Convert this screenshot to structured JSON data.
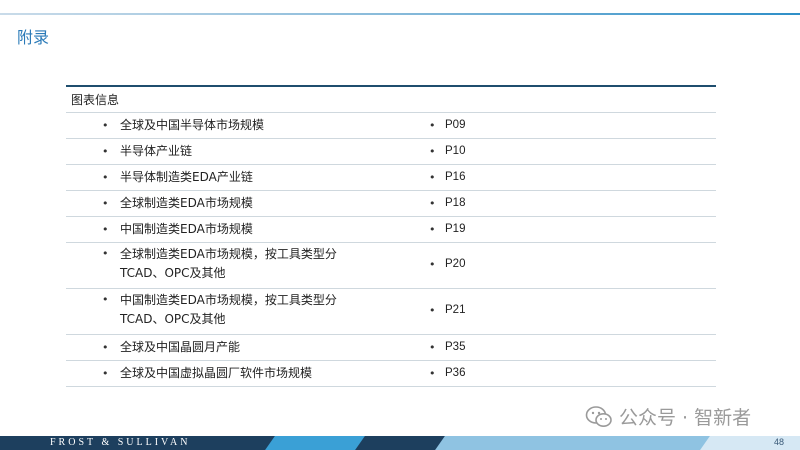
{
  "page": {
    "title": "附录",
    "page_number": "48"
  },
  "table": {
    "header": "图表信息",
    "bullet": "•",
    "rows": [
      {
        "lines": [
          "全球及中国半导体市场规模"
        ],
        "page": "P09"
      },
      {
        "lines": [
          "半导体产业链"
        ],
        "page": "P10"
      },
      {
        "lines": [
          "半导体制造类EDA产业链"
        ],
        "page": "P16"
      },
      {
        "lines": [
          "全球制造类EDA市场规模"
        ],
        "page": "P18"
      },
      {
        "lines": [
          "中国制造类EDA市场规模"
        ],
        "page": "P19"
      },
      {
        "lines": [
          "全球制造类EDA市场规模，按工具类型分",
          "TCAD、OPC及其他"
        ],
        "page": "P20"
      },
      {
        "lines": [
          "中国制造类EDA市场规模，按工具类型分",
          "TCAD、OPC及其他"
        ],
        "page": "P21"
      },
      {
        "lines": [
          "全球及中国晶圆月产能"
        ],
        "page": "P35"
      },
      {
        "lines": [
          "全球及中国虚拟晶圆厂软件市场规模"
        ],
        "page": "P36"
      }
    ]
  },
  "watermark": {
    "text": "公众号 · 智新者",
    "icon": "wechat-icon"
  },
  "footer": {
    "brand": "FROST & SULLIVAN"
  },
  "colors": {
    "title": "#2a7ab8",
    "table_rule": "#1f4e6e",
    "footer_dark": "#1d3f5e",
    "footer_accent": "#2f93cf"
  }
}
